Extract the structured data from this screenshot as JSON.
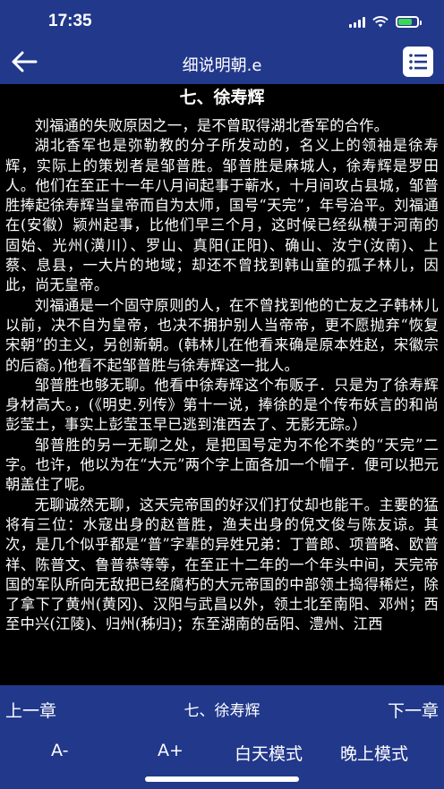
{
  "status": {
    "time": "17:35",
    "battery_level": 0.75,
    "battery_color": "#3ad65a"
  },
  "nav": {
    "title": "细说明朝.e",
    "back_icon": "arrow-left-icon",
    "menu_icon": "list-icon"
  },
  "reader": {
    "chapter_heading": "七、徐寿辉",
    "paragraphs": [
      "刘福通的失败原因之一，是不曾取得湖北香军的合作。",
      "湖北香军也是弥勒教的分子所发动的，名义上的领袖是徐寿辉，实际上的策划者是邹普胜。邹普胜是麻城人，徐寿辉是罗田人。他们在至正十一年八月间起事于蕲水，十月间攻占县城，邹普胜捧起徐寿辉当皇帝而自为太师，国号“天完”，年号治平。刘福通在(安徽）颍州起事，比他们早三个月，这时候已经纵横于河南的固始、光州(潢川）、罗山、真阳(正阳)、确山、汝宁(汝南)、上蔡、息县，一大片的地域；却还不曾找到韩山童的孤子林儿，因此，尚无皇帝。",
      "刘福通是一个固守原则的人，在不曾找到他的亡友之子韩林儿以前，决不自为皇帝，也决不拥护别人当帝帝，更不愿抛弃“恢复宋朝”的主义，另创新朝。(韩林儿在他看来确是原本姓赵，宋徽宗的后裔。)他看不起邹普胜与徐寿辉这一批人。",
      "邹普胜也够无聊。他看中徐寿辉这个布贩子．只是为了徐寿辉身材高大。，(《明史.列传》第十一说，捧徐的是个传布妖言的和尚彭莹土，事实上彭莹玉早已逃到淮西去了、无影无踪。）",
      "邹普胜的另一无聊之处，是把国号定为不伦不类的“天完”二字。也许，他以为在“大元”两个字上面各加一个帽子．便可以把元朝盖住了呢。",
      "无聊诚然无聊，这天完帝国的好汉们打仗却也能干。主要的猛将有三位：水寇出身的赵普胜，渔夫出身的倪文俊与陈友谅。其次，是几个似乎都是“普”字辈的异姓兄弟：丁普郎、项普略、欧普祥、陈普文、鲁普恭等等，在至正十二年的一个年头中间，天完帝国的军队所向无敌把已经腐朽的大元帝国的中部领土捣得稀烂，除了拿下了黄州(黄冈)、汉阳与武昌以外，领土北至南阳、邓州；西至中兴(江陵)、归州(秭归)；东至湖南的岳阳、澧州、江西"
    ]
  },
  "bottom": {
    "prev_label": "上一章",
    "current_chapter": "七、徐寿辉",
    "next_label": "下一章",
    "font_smaller": "A-",
    "font_larger": "A+",
    "day_mode": "白天模式",
    "night_mode": "晚上模式"
  },
  "colors": {
    "bar_blue": "#22388b",
    "reader_bg": "#000000",
    "reader_text": "#ffffff"
  }
}
